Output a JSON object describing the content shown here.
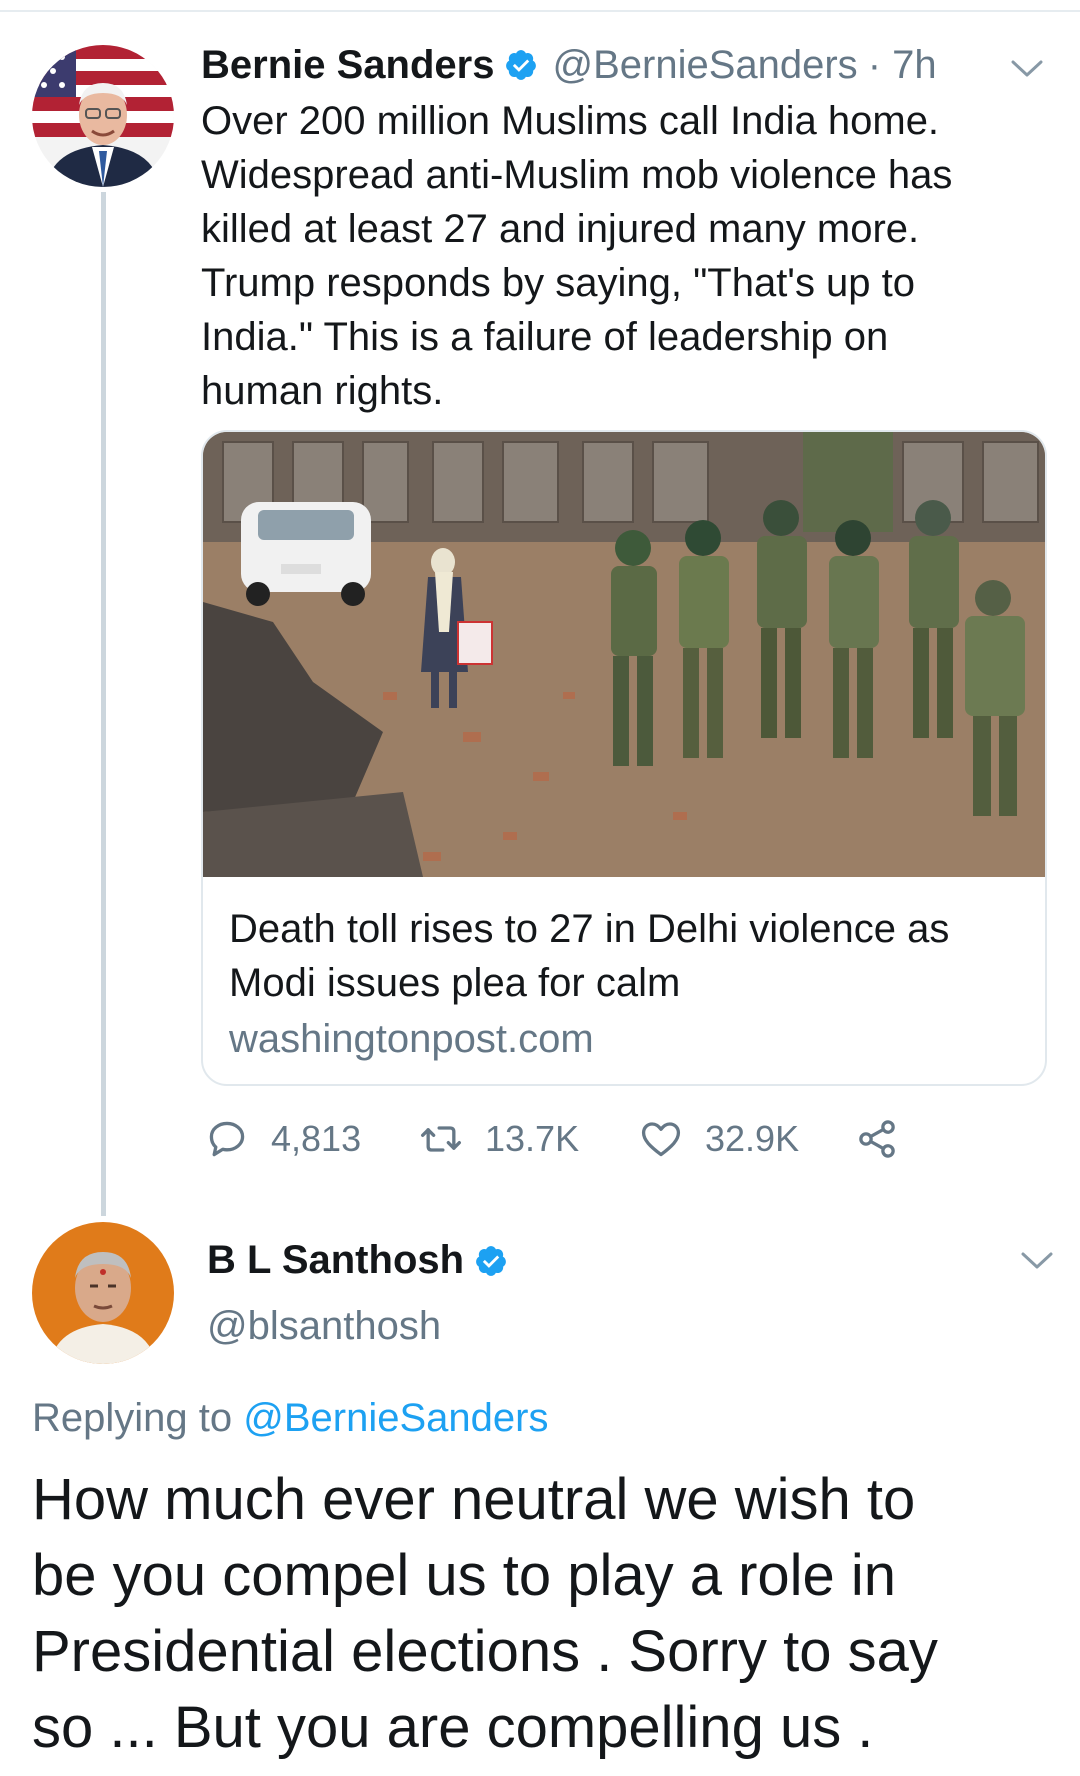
{
  "tweet": {
    "author_name": "Bernie Sanders",
    "handle": "@BernieSanders",
    "time": "· 7h",
    "verified": true,
    "text_lines": [
      "Over 200 million Muslims call India home.",
      "Widespread anti-Muslim mob violence has",
      "killed at least 27 and injured many more.",
      "Trump responds by saying, \"That's up to",
      "India.\" This is a failure of leadership on",
      "human rights."
    ],
    "card": {
      "title_lines": [
        "Death toll rises to 27 in Delhi violence as",
        "Modi issues plea for calm"
      ],
      "domain": "washingtonpost.com"
    },
    "stats": {
      "replies": "4,813",
      "retweets": "13.7K",
      "likes": "32.9K"
    }
  },
  "reply": {
    "author_name": "B L Santhosh",
    "handle": "@blsanthosh",
    "verified": true,
    "replying_prefix": "Replying to",
    "replying_to": "@BernieSanders",
    "text_lines": [
      "How much ever neutral we wish to",
      "be you compel us to play a role in",
      "Presidential elections . Sorry to say",
      "so ... But you are compelling us ."
    ]
  },
  "colors": {
    "text_primary": "#14171a",
    "text_secondary": "#657786",
    "link": "#1da1f2",
    "verified_badge": "#1da1f2",
    "border": "#e1e8ed",
    "thread_line": "#ccd6dd"
  },
  "icons": [
    "verified-icon",
    "chevron-down-icon",
    "reply-icon",
    "retweet-icon",
    "like-icon",
    "share-icon"
  ]
}
